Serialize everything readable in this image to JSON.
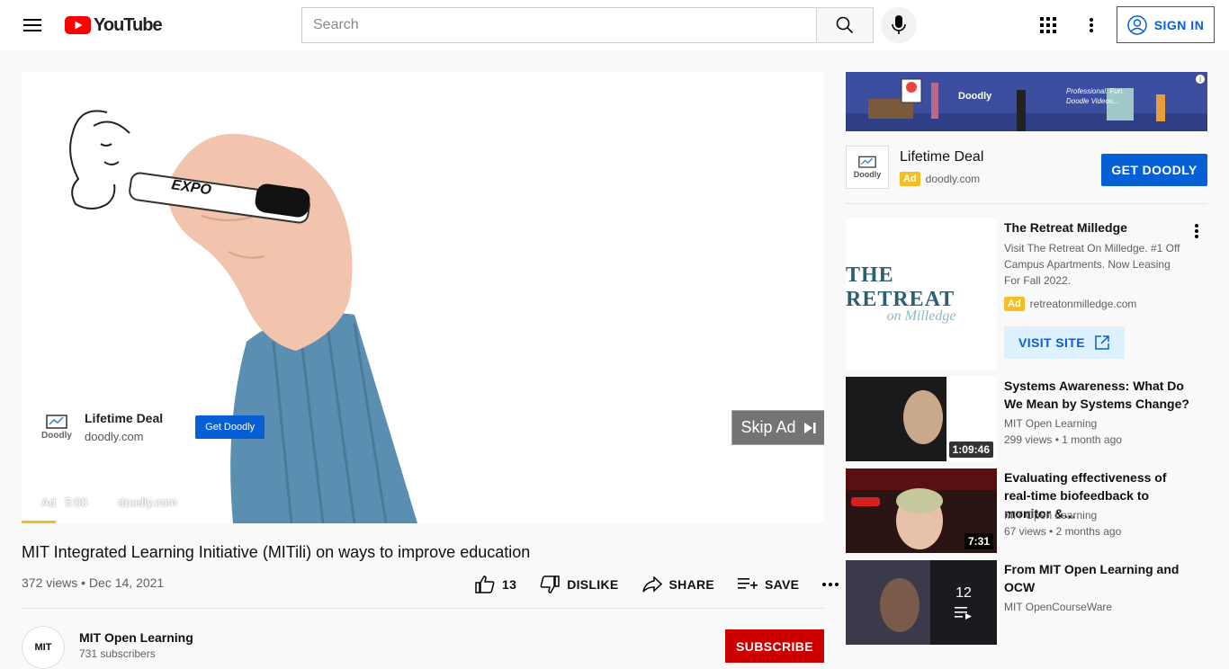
{
  "masthead": {
    "logo_text": "YouTube",
    "search_placeholder": "Search",
    "signin_label": "SIGN IN"
  },
  "player": {
    "ad": {
      "title": "Lifetime Deal",
      "domain": "doodly.com",
      "cta": "Get Doodly",
      "logo_text": "Doodly",
      "bottom_label": "Ad",
      "bottom_time": "5:00",
      "bottom_domain": "doodly.com"
    },
    "skip_label": "Skip Ad",
    "progress_fraction": 0.043
  },
  "video": {
    "title": "MIT Integrated Learning Initiative (MITili) on ways to improve education",
    "views_date": "372 views • Dec 14, 2021",
    "likes": "13",
    "dislike_label": "DISLIKE",
    "share_label": "SHARE",
    "save_label": "SAVE"
  },
  "channel": {
    "name": "MIT Open Learning",
    "subscribers": "731 subscribers",
    "subscribe_label": "SUBSCRIBE",
    "avatar_text": "MIT"
  },
  "sidebar": {
    "banner": {
      "logo_text": "Doodly",
      "text": "Professional. Fun. Doodle Videos..."
    },
    "ad_card": {
      "title": "Lifetime Deal",
      "badge": "Ad",
      "domain": "doodly.com",
      "logo_text": "Doodly",
      "cta": "GET DOODLY"
    },
    "promo": {
      "title": "The Retreat Milledge",
      "description": "Visit The Retreat On Milledge. #1 Off Campus Apartments. Now Leasing For Fall 2022.",
      "badge": "Ad",
      "domain": "retreatonmilledge.com",
      "cta": "VISIT SITE",
      "thumb_title": "THE RETREAT",
      "thumb_subtitle": "on Milledge"
    },
    "recommendations": [
      {
        "title": "Systems Awareness: What Do We Mean by Systems Change?",
        "channel": "MIT Open Learning",
        "meta": "299 views • 1 month ago",
        "duration": "1:09:46"
      },
      {
        "title": "Evaluating effectiveness of real-time biofeedback to monitor &…",
        "channel": "MIT Open Learning",
        "meta": "67 views • 2 months ago",
        "duration": "7:31"
      },
      {
        "title": "From MIT Open Learning and OCW",
        "channel": "MIT OpenCourseWare",
        "playlist_count": "12"
      }
    ]
  }
}
